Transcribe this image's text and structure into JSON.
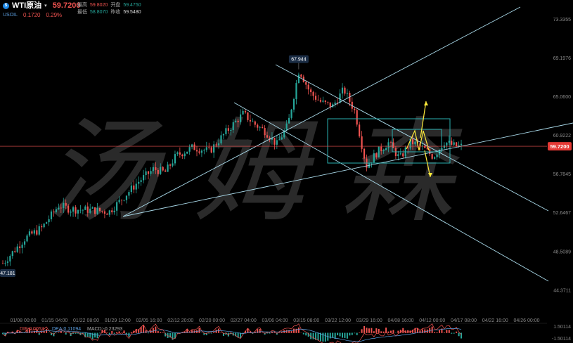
{
  "header": {
    "logo_icon": "oil-icon",
    "symbol": "WTI原油",
    "last_price": "59.7200",
    "ticker": "USOIL",
    "change": "0.1720",
    "change_pct": "0.29%",
    "high_label": "最高",
    "high": "59.8020",
    "open_label": "开盘",
    "open": "59.4750",
    "low_label": "最低",
    "low": "58.8070",
    "prev_label": "昨收",
    "prev_close": "59.5480"
  },
  "colors": {
    "up": "#26a69a",
    "down": "#ef5350",
    "trendline": "#a8d8e8",
    "box": "#2ab0b0",
    "arrow": "#ffeb3b",
    "price_line": "#ef5350",
    "label_bg": "#1b2d45",
    "price_badge": "#e53935"
  },
  "chart_data": [
    {
      "type": "candlestick",
      "price_axis": [
        "73.3355",
        "69.1976",
        "65.0600",
        "60.9222",
        "56.7845",
        "52.6467",
        "48.5089",
        "44.3711"
      ],
      "time_axis": [
        "01/08 00:00",
        "01/15 04:00",
        "01/22 08:00",
        "01/29 12:00",
        "02/05 16:00",
        "02/12 20:00",
        "02/20 00:00",
        "02/27 04:00",
        "03/06 04:00",
        "03/15 08:00",
        "03/22 12:00",
        "03/29 16:00",
        "04/08 16:00",
        "04/12 00:00",
        "04/17 08:00",
        "04/22 16:00",
        "04/26 00:00"
      ],
      "ylim": [
        42.9,
        74.6
      ],
      "trend_path": [
        [
          0,
          47.2
        ],
        [
          4,
          49.9
        ],
        [
          7,
          51.0
        ],
        [
          10,
          53.4
        ],
        [
          12,
          53.0
        ],
        [
          16,
          52.9
        ],
        [
          19,
          52.7
        ],
        [
          21,
          53.9
        ],
        [
          24,
          55.8
        ],
        [
          27,
          57.3
        ],
        [
          29,
          56.9
        ],
        [
          31,
          58.7
        ],
        [
          34,
          59.6
        ],
        [
          37,
          59.2
        ],
        [
          40,
          61.3
        ],
        [
          43,
          63.2
        ],
        [
          45,
          62.1
        ],
        [
          47,
          61.3
        ],
        [
          49,
          59.9
        ],
        [
          51,
          62.0
        ],
        [
          53,
          67.944
        ],
        [
          55,
          65.4
        ],
        [
          57,
          64.4
        ],
        [
          59,
          64.0
        ],
        [
          61,
          65.8
        ],
        [
          63,
          63.4
        ],
        [
          64,
          60.5
        ],
        [
          65,
          57.6
        ],
        [
          67,
          59.1
        ],
        [
          69,
          60.1
        ],
        [
          71,
          58.4
        ],
        [
          73,
          60.2
        ],
        [
          75,
          59.6
        ],
        [
          77,
          58.6
        ],
        [
          79,
          60.2
        ],
        [
          81,
          59.7
        ],
        [
          82,
          59.72
        ]
      ],
      "bars": 190,
      "last_price": "59.7200",
      "annotations": [
        {
          "text": "67.944",
          "kind": "high"
        },
        {
          "text": "47.181",
          "kind": "low"
        }
      ],
      "grid": false,
      "watermark": "汤姆森"
    },
    {
      "type": "macd",
      "legend": [
        {
          "name": "DIF",
          "value": "0.0053",
          "color": "#ef5350"
        },
        {
          "name": "DEA",
          "value": "0.11094",
          "color": "#5c9fe0"
        },
        {
          "name": "MACD",
          "value": "-0.23293",
          "color": "#aaa"
        }
      ],
      "axis": [
        "1.50114",
        "-1.50114"
      ],
      "ylim": [
        -1.6,
        1.6
      ]
    }
  ]
}
